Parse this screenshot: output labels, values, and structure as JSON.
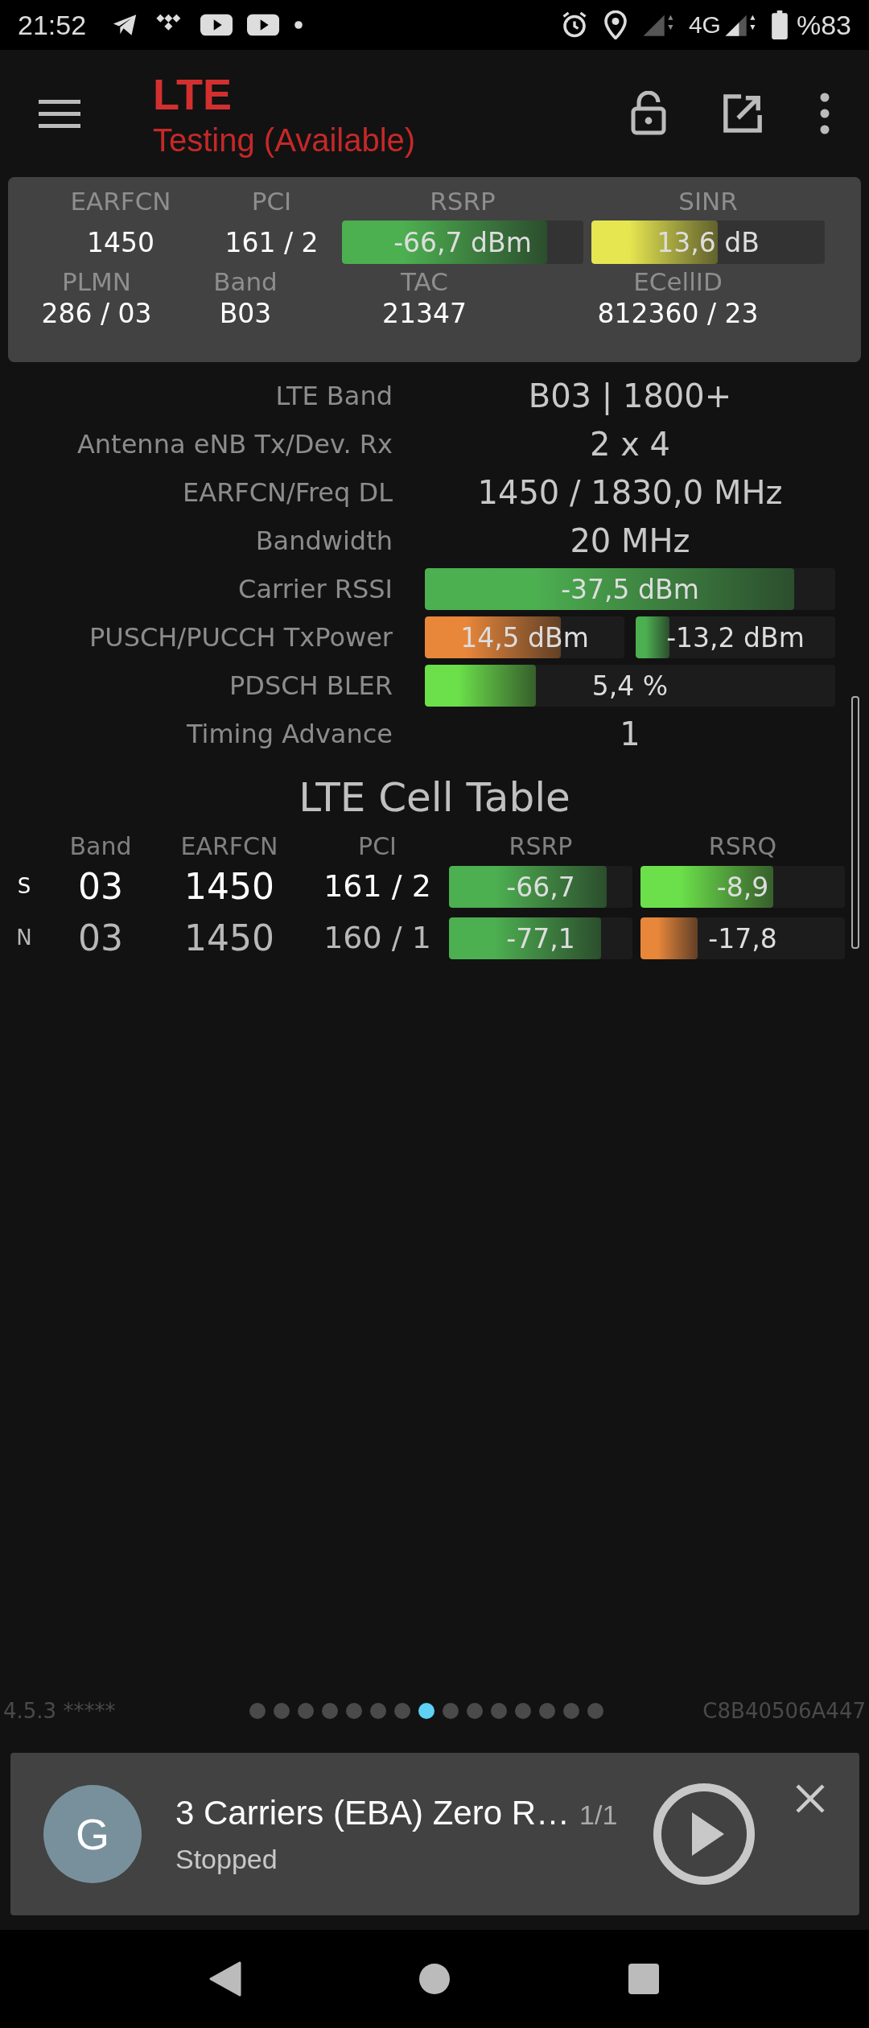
{
  "status_bar": {
    "time": "21:52",
    "network": "4G",
    "battery": "%83"
  },
  "app_bar": {
    "title": "LTE",
    "subtitle": "Testing (Available)"
  },
  "summary": {
    "row1": [
      {
        "label": "EARFCN",
        "kind": "text",
        "value": "1450"
      },
      {
        "label": "PCI",
        "kind": "text",
        "value": "161 / 2"
      },
      {
        "label": "RSRP",
        "kind": "bar",
        "value": "-66,7 dBm",
        "level": 0.85,
        "color": "#4caf50"
      },
      {
        "label": "SINR",
        "kind": "bar",
        "value": "13,6 dB",
        "level": 0.54,
        "color": "#e6e650"
      }
    ],
    "row2": [
      {
        "label": "PLMN",
        "value": "286 / 03"
      },
      {
        "label": "Band",
        "value": "B03"
      },
      {
        "label": "TAC",
        "value": "21347"
      },
      {
        "label": "ECellID",
        "value": "812360 / 23"
      }
    ]
  },
  "details": [
    {
      "label": "LTE Band",
      "kind": "text",
      "value": "B03 | 1800+"
    },
    {
      "label": "Antenna eNB Tx/Dev. Rx",
      "kind": "text",
      "value": "2 x 4"
    },
    {
      "label": "EARFCN/Freq DL",
      "kind": "text",
      "value": "1450 / 1830,0 MHz"
    },
    {
      "label": "Bandwidth",
      "kind": "text",
      "value": "20 MHz"
    },
    {
      "label": "Carrier RSSI",
      "kind": "bar",
      "bars": [
        {
          "value": "-37,5 dBm",
          "level": 0.9,
          "color": "#4caf50"
        }
      ]
    },
    {
      "label": "PUSCH/PUCCH TxPower",
      "kind": "bar",
      "bars": [
        {
          "value": "14,5 dBm",
          "level": 0.68,
          "color": "#e8873a"
        },
        {
          "value": "-13,2 dBm",
          "level": 0.17,
          "color": "#4caf50"
        }
      ]
    },
    {
      "label": "PDSCH BLER",
      "kind": "bar",
      "bars": [
        {
          "value": "5,4 %",
          "level": 0.27,
          "color": "#6be04a"
        }
      ]
    },
    {
      "label": "Timing Advance",
      "kind": "text",
      "value": "1"
    }
  ],
  "cell_table": {
    "title": "LTE Cell Table",
    "columns": [
      "Band",
      "EARFCN",
      "PCI",
      "RSRP",
      "RSRQ"
    ],
    "rows": [
      {
        "kind": "serving",
        "type": "S",
        "band": "03",
        "earfcn": "1450",
        "pci": "161 / 2",
        "rsrp": {
          "value": "-66,7",
          "level": 0.86,
          "color": "#4caf50"
        },
        "rsrq": {
          "value": "-8,9",
          "level": 0.65,
          "color": "#6be04a"
        }
      },
      {
        "kind": "neighbor",
        "type": "N",
        "band": "03",
        "earfcn": "1450",
        "pci": "160 / 1",
        "rsrp": {
          "value": "-77,1",
          "level": 0.83,
          "color": "#4caf50"
        },
        "rsrq": {
          "value": "-17,8",
          "level": 0.28,
          "color": "#e8873a"
        }
      }
    ]
  },
  "footer": {
    "version": "4.5.3 *****",
    "device_id": "C8B40506A447",
    "pages": [
      {
        "selected": false
      },
      {
        "selected": false
      },
      {
        "selected": false
      },
      {
        "selected": false
      },
      {
        "selected": false
      },
      {
        "selected": false
      },
      {
        "selected": false
      },
      {
        "selected": true
      },
      {
        "selected": false
      },
      {
        "selected": false
      },
      {
        "selected": false
      },
      {
        "selected": false
      },
      {
        "selected": false
      },
      {
        "selected": false
      },
      {
        "selected": false
      }
    ]
  },
  "player": {
    "avatar": "G",
    "title": "3 Carriers (EBA) Zero R…",
    "count": "1/1",
    "status": "Stopped"
  }
}
